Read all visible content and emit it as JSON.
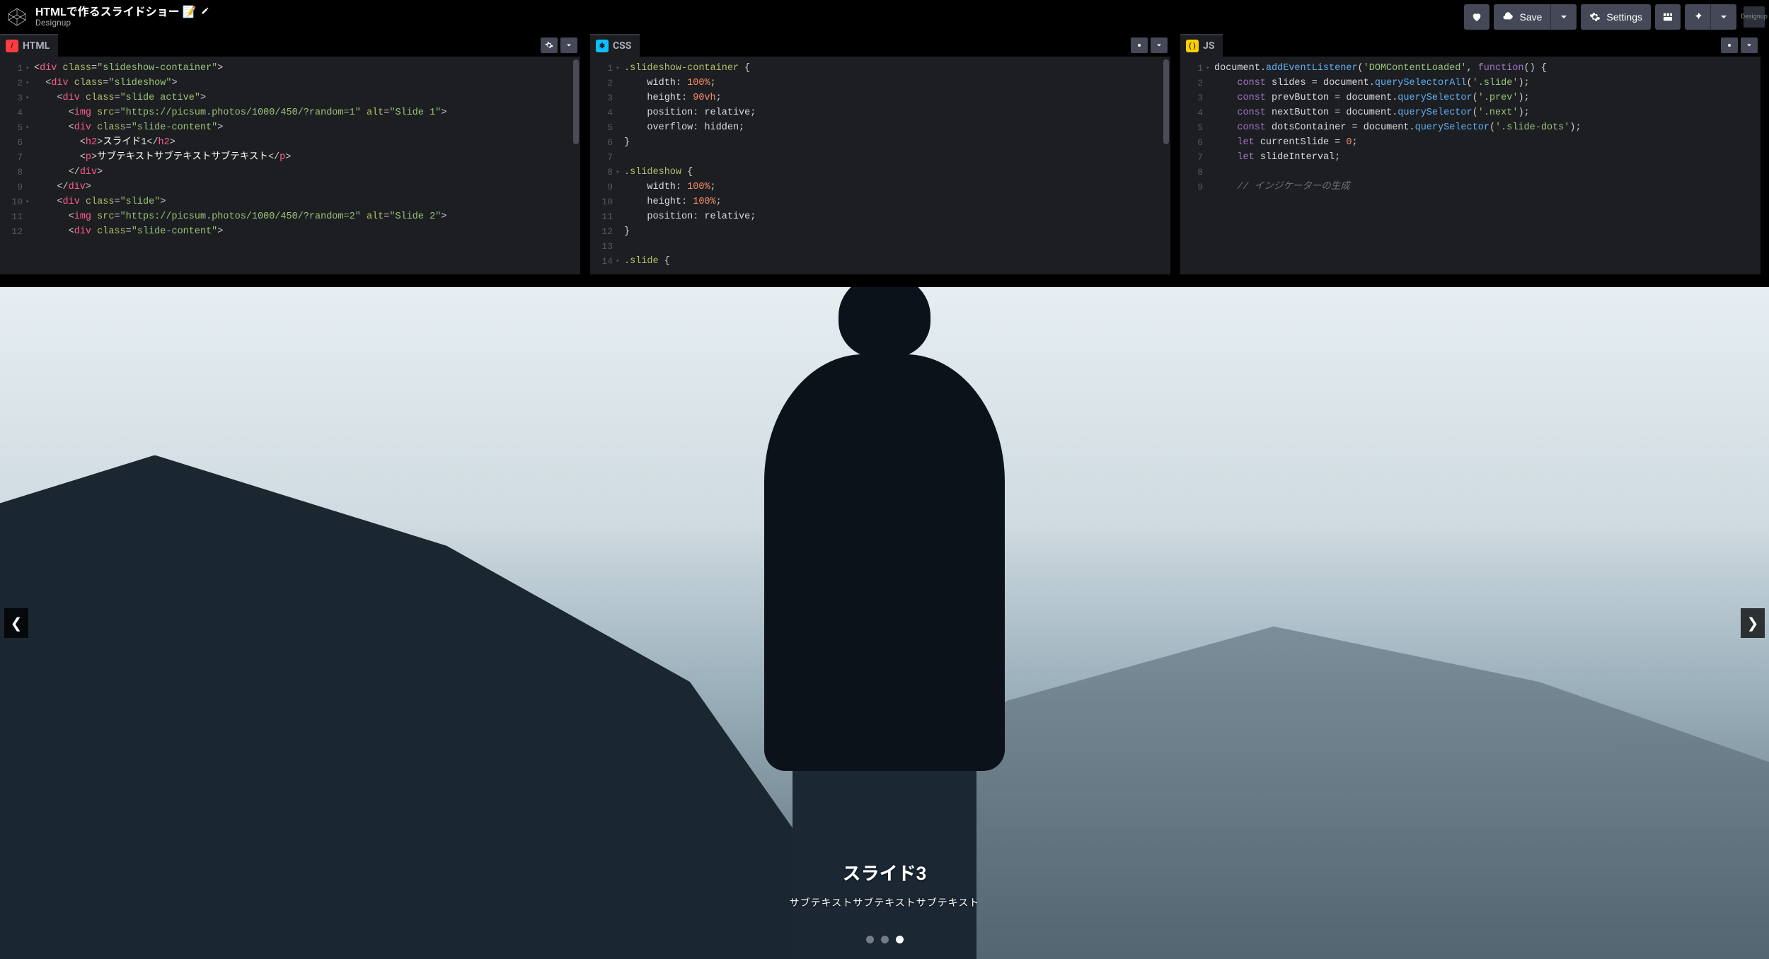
{
  "header": {
    "pen_title": "HTMLで作るスライドショー 📝",
    "author": "Designup",
    "save_label": "Save",
    "settings_label": "Settings",
    "avatar_text": "Designup"
  },
  "editors": {
    "html": {
      "label": "HTML",
      "line_numbers": [
        "1",
        "2",
        "3",
        "4",
        "5",
        "6",
        "7",
        "8",
        "9",
        "10",
        "11",
        "12"
      ],
      "lines_html": [
        "<span class='t-punc'>&lt;</span><span class='t-tag'>div</span> <span class='t-attr'>class</span><span class='t-punc'>=</span><span class='t-str'>\"slideshow-container\"</span><span class='t-punc'>&gt;</span>",
        "  <span class='t-punc'>&lt;</span><span class='t-tag'>div</span> <span class='t-attr'>class</span><span class='t-punc'>=</span><span class='t-str'>\"slideshow\"</span><span class='t-punc'>&gt;</span>",
        "    <span class='t-punc'>&lt;</span><span class='t-tag'>div</span> <span class='t-attr'>class</span><span class='t-punc'>=</span><span class='t-str'>\"slide active\"</span><span class='t-punc'>&gt;</span>",
        "      <span class='t-punc'>&lt;</span><span class='t-tag'>img</span> <span class='t-attr'>src</span><span class='t-punc'>=</span><span class='t-str'>\"https://picsum.photos/1000/450/?random=1\"</span> <span class='t-attr'>alt</span><span class='t-punc'>=</span><span class='t-str'>\"Slide 1\"</span><span class='t-punc'>&gt;</span>",
        "      <span class='t-punc'>&lt;</span><span class='t-tag'>div</span> <span class='t-attr'>class</span><span class='t-punc'>=</span><span class='t-str'>\"slide-content\"</span><span class='t-punc'>&gt;</span>",
        "        <span class='t-punc'>&lt;</span><span class='t-tag'>h2</span><span class='t-punc'>&gt;</span><span class='t-text'>スライド1</span><span class='t-punc'>&lt;/</span><span class='t-tag'>h2</span><span class='t-punc'>&gt;</span>",
        "        <span class='t-punc'>&lt;</span><span class='t-tag'>p</span><span class='t-punc'>&gt;</span><span class='t-text'>サブテキストサブテキストサブテキスト</span><span class='t-punc'>&lt;/</span><span class='t-tag'>p</span><span class='t-punc'>&gt;</span>",
        "      <span class='t-punc'>&lt;/</span><span class='t-tag'>div</span><span class='t-punc'>&gt;</span>",
        "    <span class='t-punc'>&lt;/</span><span class='t-tag'>div</span><span class='t-punc'>&gt;</span>",
        "    <span class='t-punc'>&lt;</span><span class='t-tag'>div</span> <span class='t-attr'>class</span><span class='t-punc'>=</span><span class='t-str'>\"slide\"</span><span class='t-punc'>&gt;</span>",
        "      <span class='t-punc'>&lt;</span><span class='t-tag'>img</span> <span class='t-attr'>src</span><span class='t-punc'>=</span><span class='t-str'>\"https://picsum.photos/1000/450/?random=2\"</span> <span class='t-attr'>alt</span><span class='t-punc'>=</span><span class='t-str'>\"Slide 2\"</span><span class='t-punc'>&gt;</span>",
        "      <span class='t-punc'>&lt;</span><span class='t-tag'>div</span> <span class='t-attr'>class</span><span class='t-punc'>=</span><span class='t-str'>\"slide-content\"</span><span class='t-punc'>&gt;</span>"
      ]
    },
    "css": {
      "label": "CSS",
      "line_numbers": [
        "1",
        "2",
        "3",
        "4",
        "5",
        "6",
        "7",
        "8",
        "9",
        "10",
        "11",
        "12",
        "13",
        "14"
      ],
      "lines_html": [
        "<span class='t-sel'>.slideshow-container</span> <span class='t-punc'>{</span>",
        "    <span class='t-prop'>width</span><span class='t-punc'>:</span> <span class='t-num'>100%</span><span class='t-punc'>;</span>",
        "    <span class='t-prop'>height</span><span class='t-punc'>:</span> <span class='t-num'>90vh</span><span class='t-punc'>;</span>",
        "    <span class='t-prop'>position</span><span class='t-punc'>:</span> <span class='t-var'>relative</span><span class='t-punc'>;</span>",
        "    <span class='t-prop'>overflow</span><span class='t-punc'>:</span> <span class='t-var'>hidden</span><span class='t-punc'>;</span>",
        "<span class='t-punc'>}</span>",
        "",
        "<span class='t-sel'>.slideshow</span> <span class='t-punc'>{</span>",
        "    <span class='t-prop'>width</span><span class='t-punc'>:</span> <span class='t-num'>100%</span><span class='t-punc'>;</span>",
        "    <span class='t-prop'>height</span><span class='t-punc'>:</span> <span class='t-num'>100%</span><span class='t-punc'>;</span>",
        "    <span class='t-prop'>position</span><span class='t-punc'>:</span> <span class='t-var'>relative</span><span class='t-punc'>;</span>",
        "<span class='t-punc'>}</span>",
        "",
        "<span class='t-sel'>.slide</span> <span class='t-punc'>{</span>"
      ]
    },
    "js": {
      "label": "JS",
      "line_numbers": [
        "1",
        "2",
        "3",
        "4",
        "5",
        "6",
        "7",
        "8",
        "9"
      ],
      "lines_html": [
        "<span class='t-var'>document</span><span class='t-punc'>.</span><span class='t-func'>addEventListener</span><span class='t-punc'>(</span><span class='t-str'>'DOMContentLoaded'</span><span class='t-punc'>,</span> <span class='t-kw'>function</span><span class='t-punc'>() {</span>",
        "    <span class='t-kw'>const</span> <span class='t-var'>slides</span> <span class='t-punc'>=</span> <span class='t-var'>document</span><span class='t-punc'>.</span><span class='t-func'>querySelectorAll</span><span class='t-punc'>(</span><span class='t-str'>'.slide'</span><span class='t-punc'>);</span>",
        "    <span class='t-kw'>const</span> <span class='t-var'>prevButton</span> <span class='t-punc'>=</span> <span class='t-var'>document</span><span class='t-punc'>.</span><span class='t-func'>querySelector</span><span class='t-punc'>(</span><span class='t-str'>'.prev'</span><span class='t-punc'>);</span>",
        "    <span class='t-kw'>const</span> <span class='t-var'>nextButton</span> <span class='t-punc'>=</span> <span class='t-var'>document</span><span class='t-punc'>.</span><span class='t-func'>querySelector</span><span class='t-punc'>(</span><span class='t-str'>'.next'</span><span class='t-punc'>);</span>",
        "    <span class='t-kw'>const</span> <span class='t-var'>dotsContainer</span> <span class='t-punc'>=</span> <span class='t-var'>document</span><span class='t-punc'>.</span><span class='t-func'>querySelector</span><span class='t-punc'>(</span><span class='t-str'>'.slide-dots'</span><span class='t-punc'>);</span>",
        "    <span class='t-kw'>let</span> <span class='t-var'>currentSlide</span> <span class='t-punc'>=</span> <span class='t-num'>0</span><span class='t-punc'>;</span>",
        "    <span class='t-kw'>let</span> <span class='t-var'>slideInterval</span><span class='t-punc'>;</span>",
        "",
        "    <span class='t-comment'>// インジケーターの生成</span>"
      ]
    }
  },
  "preview": {
    "slide_title": "スライド3",
    "slide_subtitle": "サブテキストサブテキストサブテキスト",
    "prev_glyph": "❮",
    "next_glyph": "❯",
    "active_dot_index": 2,
    "dot_count": 3
  }
}
